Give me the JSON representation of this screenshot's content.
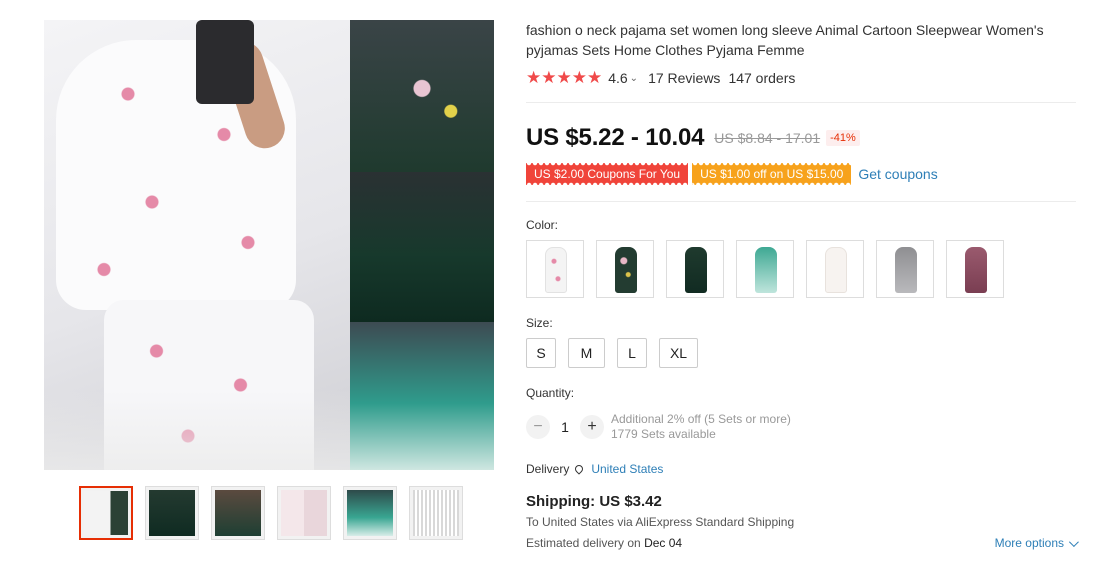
{
  "product": {
    "title": "fashion o neck pajama set women long sleeve Animal Cartoon Sleepwear Women's pyjamas Sets Home Clothes Pyjama Femme",
    "rating": "4.6",
    "reviews": "17 Reviews",
    "orders": "147 orders",
    "price": "US $5.22 - 10.04",
    "old_price": "US $8.84 - 17.01",
    "discount": "-41%"
  },
  "coupons": {
    "coupon1": "US $2.00 Coupons For You",
    "coupon2": "US $1.00 off on US $15.00",
    "get_coupons": "Get coupons"
  },
  "options": {
    "color_label": "Color:",
    "size_label": "Size:",
    "sizes": [
      "S",
      "M",
      "L",
      "XL"
    ],
    "quantity_label": "Quantity:",
    "quantity": "1",
    "qty_minus": "−",
    "qty_plus": "+",
    "discount_note": "Additional 2% off (5 Sets or more)",
    "available": "1779 Sets available"
  },
  "delivery": {
    "label": "Delivery",
    "country": "United States",
    "shipping_title": "Shipping: US $3.42",
    "shipping_via": "To United States via AliExpress Standard Shipping",
    "eta_prefix": "Estimated delivery on ",
    "eta_date": "Dec 04",
    "more_options": "More options"
  },
  "icons": {
    "stars": "★★★★★",
    "chevron": "⌄"
  },
  "colors": {
    "accent_red": "#e62e04",
    "star_red": "#f04a4a",
    "link_blue": "#2e7fb7",
    "coupon_red": "#f0443a",
    "coupon_orange": "#f7a21c"
  }
}
